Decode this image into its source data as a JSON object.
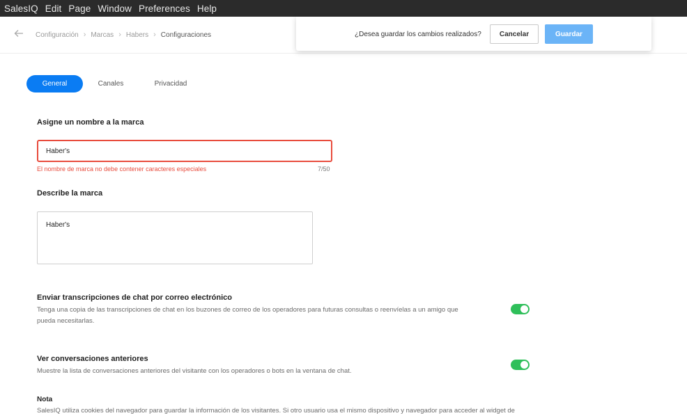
{
  "menubar": {
    "items": [
      "SalesIQ",
      "Edit",
      "Page",
      "Window",
      "Preferences",
      "Help"
    ]
  },
  "breadcrumb": [
    "Configuración",
    "Marcas",
    "Habers",
    "Configuraciones"
  ],
  "save_prompt": {
    "question": "¿Desea guardar los cambios realizados?",
    "cancel_label": "Cancelar",
    "save_label": "Guardar"
  },
  "tabs": [
    {
      "label": "General",
      "active": true
    },
    {
      "label": "Canales",
      "active": false
    },
    {
      "label": "Privacidad",
      "active": false
    }
  ],
  "brand_name": {
    "label": "Asigne un nombre a la marca",
    "value": "Haber's",
    "error": "El nombre de marca no debe contener caracteres especiales",
    "counter": "7/50"
  },
  "brand_description": {
    "label": "Describe la marca",
    "value": "Haber's"
  },
  "email_transcripts": {
    "title": "Enviar transcripciones de chat por correo electrónico",
    "description_line1": "Tenga una copia de las transcripciones de chat en los buzones de correo de los operadores para futuras consultas o reenvíelas a un amigo que",
    "description_line2": "pueda necesitarlas.",
    "enabled": true
  },
  "past_conversations": {
    "title": "Ver conversaciones anteriores",
    "description": "Muestre la lista de conversaciones anteriores del visitante con los operadores o bots en la ventana de chat.",
    "enabled": true
  },
  "note": {
    "title": "Nota",
    "text": "SalesIQ utiliza cookies del navegador para guardar la información de los visitantes. Si otro usuario usa el mismo dispositivo y navegador para acceder al widget de"
  },
  "colors": {
    "accent": "#0a7cf3",
    "save_button": "#6bb4f7",
    "error": "#e84b3c",
    "toggle_on": "#2fbf5a"
  }
}
